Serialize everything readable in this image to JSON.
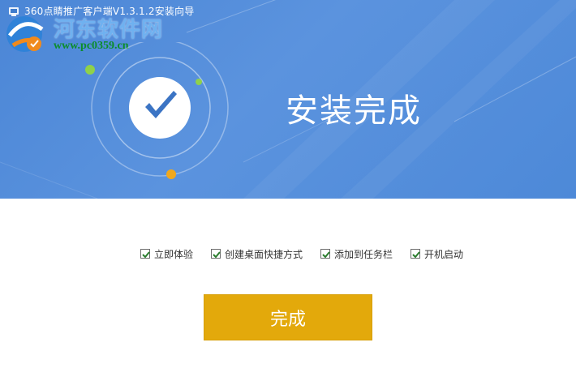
{
  "window": {
    "title": "360点睛推广客户端V1.3.1.2安装向导"
  },
  "watermark": {
    "name": "河东软件网",
    "url": "www.pc0359.cn"
  },
  "banner": {
    "headline": "安装完成",
    "success_icon": "checkmark-icon"
  },
  "options": [
    {
      "label": "立即体验",
      "checked": true
    },
    {
      "label": "创建桌面快捷方式",
      "checked": true
    },
    {
      "label": "添加到任务栏",
      "checked": true
    },
    {
      "label": "开机启动",
      "checked": true
    }
  ],
  "actions": {
    "finish_label": "完成"
  },
  "colors": {
    "banner_blue": "#4b86d6",
    "button_gold": "#e3a90b",
    "check_green": "#2a7d2e",
    "orbit_green": "#8fd14a",
    "orbit_orange": "#f0a81e"
  }
}
